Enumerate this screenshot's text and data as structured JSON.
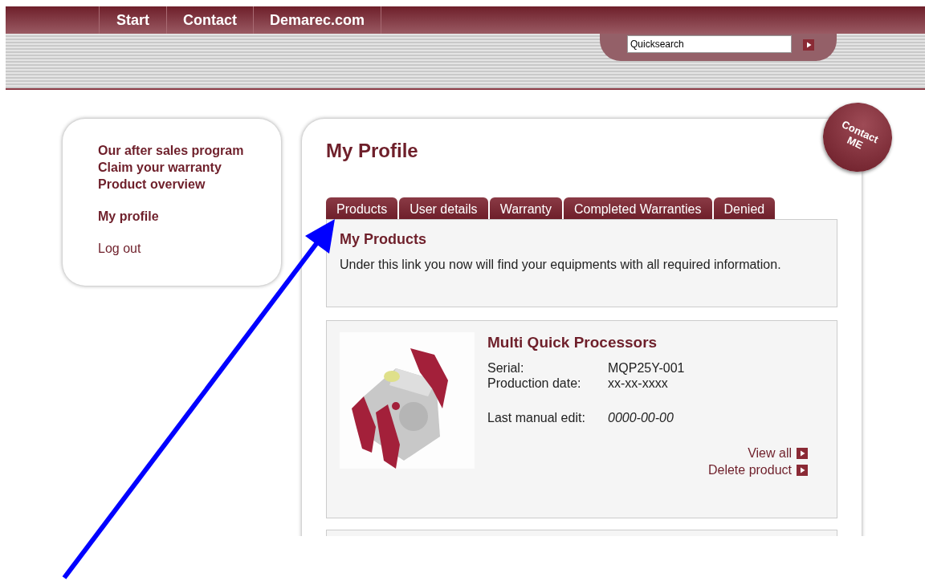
{
  "nav": {
    "links": [
      "Start",
      "Contact",
      "Demarec.com"
    ]
  },
  "quicksearch": {
    "value": "Quicksearch"
  },
  "sidebar": {
    "groups": [
      [
        "Our after sales program",
        "Claim your warranty",
        "Product overview"
      ],
      [
        "My profile"
      ],
      [
        "Log out"
      ]
    ]
  },
  "contact_badge": {
    "lines": [
      "Contact",
      "ME"
    ]
  },
  "page_title": "My Profile",
  "tabs": [
    {
      "label": "Products"
    },
    {
      "label": "User details"
    },
    {
      "label": "Warranty"
    },
    {
      "label": "Completed Warranties"
    },
    {
      "label": "Denied"
    }
  ],
  "intro": {
    "heading": "My Products",
    "text": "Under this link you now will find your equipments with all required information."
  },
  "products": [
    {
      "image": {
        "kind": "picture"
      },
      "name": "Multi Quick Processors",
      "fields": [
        {
          "label": "Serial:",
          "value": "MQP25Y-001"
        },
        {
          "label": "Production date:",
          "value": "xx-xx-xxxx"
        },
        {
          "label": "Last manual edit:",
          "value": "0000-00-00",
          "italic": true
        }
      ],
      "actions": [
        "View all",
        "Delete product"
      ]
    }
  ]
}
